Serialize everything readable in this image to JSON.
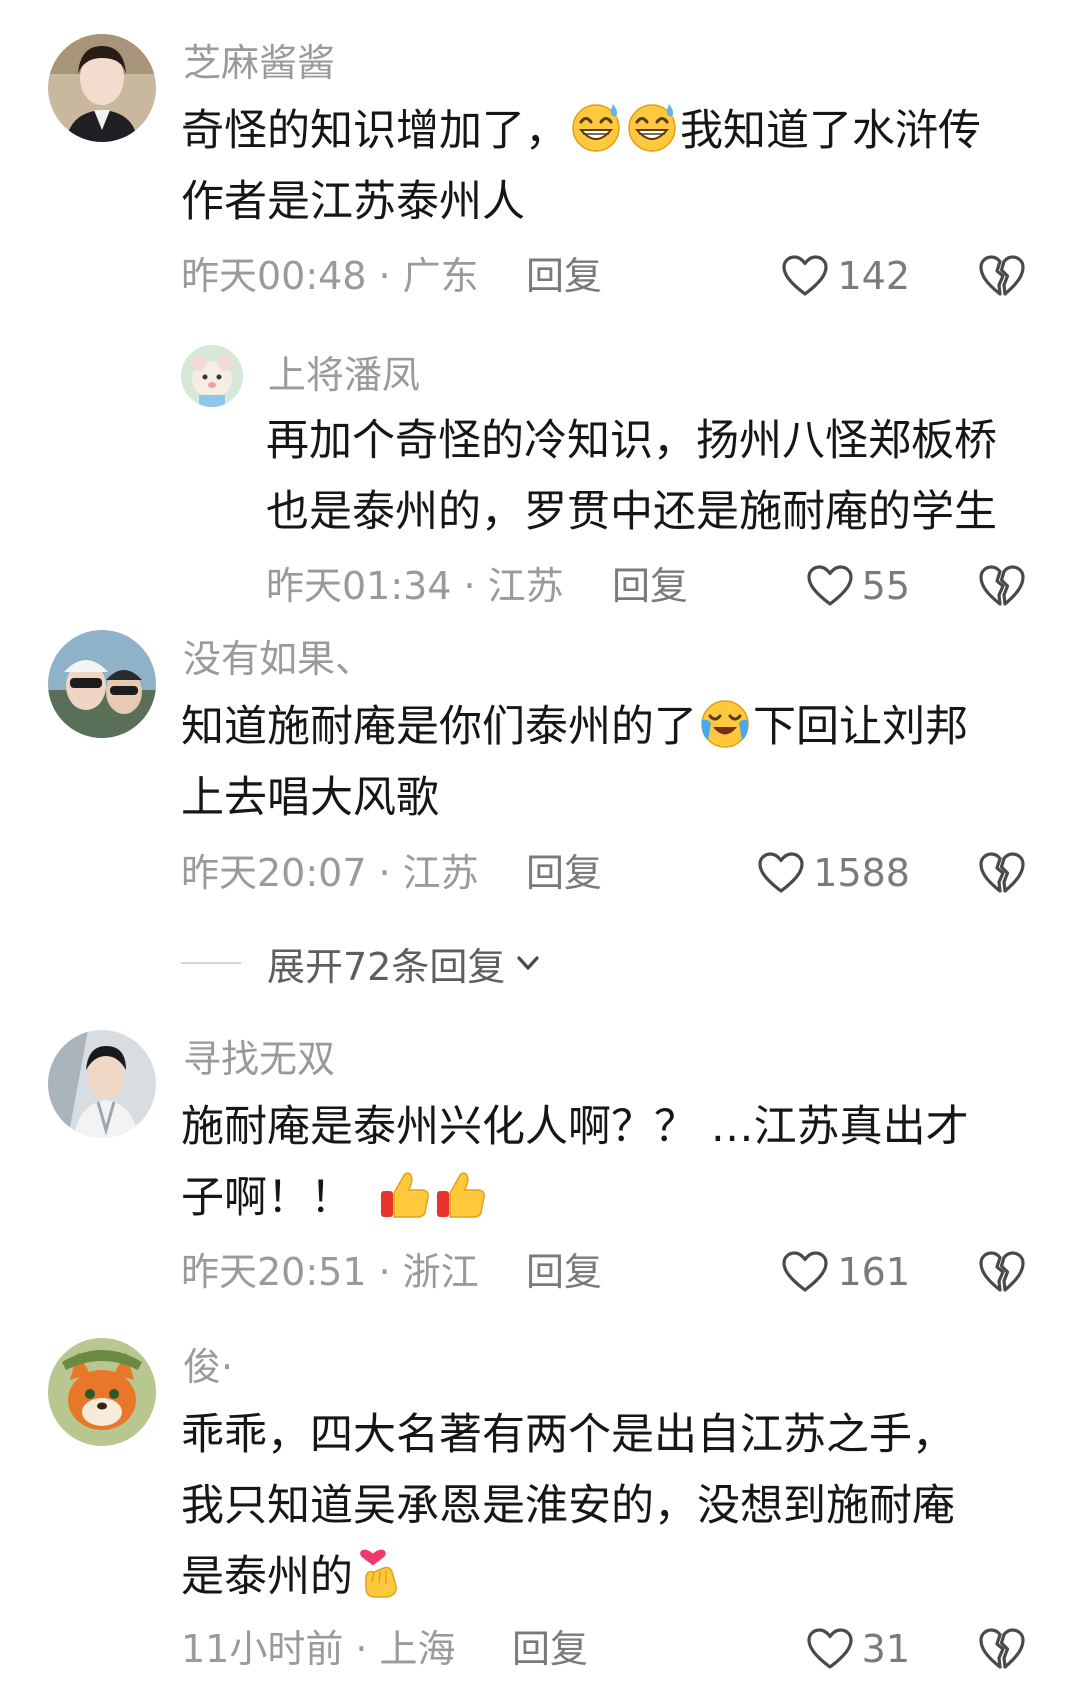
{
  "comments": [
    {
      "username": "芝麻酱酱",
      "lines": [
        "奇怪的知识增加了，",
        "我知道了水浒传",
        "作者是江苏泰州人"
      ],
      "emoji": [
        "grinning-sweat-emoji",
        "grinning-sweat-emoji"
      ],
      "time": "昨天00:48",
      "location": "广东",
      "reply_label": "回复",
      "likes": "142",
      "replies": [
        {
          "username": "上将潘凤",
          "lines": [
            "再加个奇怪的冷知识，扬州八怪郑板桥",
            "也是泰州的，罗贯中还是施耐庵的学生"
          ],
          "time": "昨天01:34",
          "location": "江苏",
          "reply_label": "回复",
          "likes": "55"
        }
      ]
    },
    {
      "username": "没有如果、",
      "lines": [
        "知道施耐庵是你们泰州的了",
        "下回让刘邦",
        "上去唱大风歌"
      ],
      "emoji": [
        "crying-laughing-emoji"
      ],
      "time": "昨天20:07",
      "location": "江苏",
      "reply_label": "回复",
      "likes": "1588",
      "expand_label": "展开72条回复"
    },
    {
      "username": "寻找无双",
      "lines": [
        "施耐庵是泰州兴化人啊？？ …江苏真出才",
        "子啊！！"
      ],
      "emoji": [
        "thumbs-up-emoji",
        "thumbs-up-emoji"
      ],
      "time": "昨天20:51",
      "location": "浙江",
      "reply_label": "回复",
      "likes": "161"
    },
    {
      "username": "俊·",
      "lines": [
        "乖乖，四大名著有两个是出自江苏之手，",
        "我只知道吴承恩是淮安的，没想到施耐庵",
        "是泰州的"
      ],
      "emoji": [
        "finger-heart-emoji"
      ],
      "time": "11小时前",
      "location": "上海",
      "reply_label": "回复",
      "likes": "31"
    }
  ],
  "separator": "·",
  "icons": {
    "like": "heart-outline-icon",
    "dislike": "broken-heart-icon",
    "expand": "chevron-down-icon"
  },
  "colors": {
    "text": "#161616",
    "meta": "#9a9a9a",
    "icon": "#4a4a4a"
  }
}
